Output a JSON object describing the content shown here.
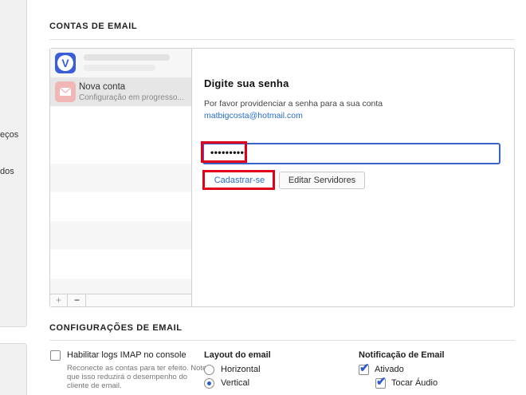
{
  "nav": {
    "fragment_1": "eços",
    "fragment_2": "dos"
  },
  "email_accounts": {
    "heading": "CONTAS DE EMAIL",
    "accounts": [
      {
        "title": "",
        "subtitle": "",
        "icon": "vivaldi-logo-icon"
      },
      {
        "title": "Nova conta",
        "subtitle": "Configuração em progresso...",
        "icon": "envelope-icon"
      }
    ],
    "toolbar": {
      "add_label": "+",
      "remove_label": "−"
    },
    "detail": {
      "title": "Digite sua senha",
      "description": "Por favor providenciar a senha para a sua conta",
      "email": "matbigcosta@hotmail.com",
      "password_value": "••••••••••",
      "register_label": "Cadastrar-se",
      "edit_servers_label": "Editar Servidores"
    },
    "highlight_color": "#e0001a",
    "accent_color": "#3a63c9"
  },
  "email_settings": {
    "heading": "CONFIGURAÇÕES DE EMAIL",
    "imap_logs": {
      "label": "Habilitar logs IMAP no console",
      "checked": false,
      "hint": "Reconecte as contas para ter efeito. Note que isso reduzirá o desempenho do cliente de email."
    },
    "layout": {
      "heading": "Layout do email",
      "options": [
        {
          "label": "Horizontal",
          "selected": false
        },
        {
          "label": "Vertical",
          "selected": true
        }
      ]
    },
    "notification": {
      "heading": "Notificação de Email",
      "enabled_label": "Ativado",
      "enabled": true,
      "sound_label": "Tocar Áudio",
      "sound": true
    }
  }
}
